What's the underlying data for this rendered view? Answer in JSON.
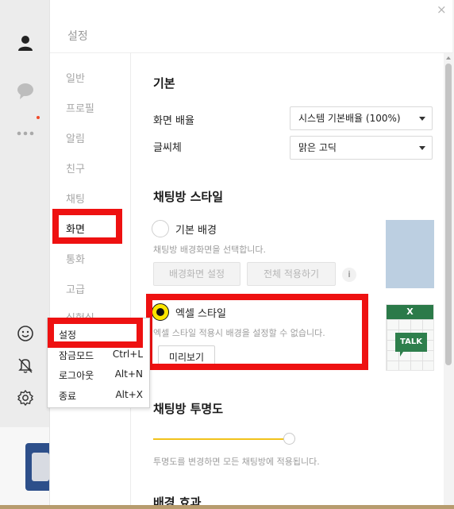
{
  "window": {
    "title": "설정",
    "close": "×"
  },
  "sidebar": {
    "items": [
      {
        "label": "일반"
      },
      {
        "label": "프로필"
      },
      {
        "label": "알림"
      },
      {
        "label": "친구"
      },
      {
        "label": "채팅"
      },
      {
        "label": "화면",
        "active": true
      },
      {
        "label": "통화"
      },
      {
        "label": "고급"
      },
      {
        "label": "실험실"
      }
    ]
  },
  "basic": {
    "section_title": "기본",
    "zoom_label": "화면 배율",
    "zoom_value": "시스템 기본배율 (100%)",
    "font_label": "글씨체",
    "font_value": "맑은 고딕"
  },
  "chat_style": {
    "section_title": "채팅방 스타일",
    "default_bg_label": "기본 배경",
    "default_bg_desc": "채팅방 배경화면을 선택합니다.",
    "set_bg_button": "배경화면 설정",
    "apply_all_button": "전체 적용하기",
    "info_icon": "i",
    "excel_label": "엑셀 스타일",
    "excel_desc": "엑셀 스타일 적용시 배경을 설정할 수 없습니다.",
    "preview_button": "미리보기",
    "excel_badge": "X",
    "talk_badge": "TALK"
  },
  "transparency": {
    "section_title": "채팅방 투명도",
    "desc": "투명도를 변경하면 모든 채팅방에 적용됩니다.",
    "level": 1.0
  },
  "background_effect": {
    "section_title": "배경 효과"
  },
  "context_menu": {
    "items": [
      {
        "label": "설정",
        "shortcut": ""
      },
      {
        "label": "잠금모드",
        "shortcut": "Ctrl+L"
      },
      {
        "label": "로그아웃",
        "shortcut": "Alt+N"
      },
      {
        "label": "종료",
        "shortcut": "Alt+X"
      }
    ]
  },
  "colors": {
    "accent_yellow": "#fde500",
    "annotation_red": "#ee1111",
    "excel_green": "#2b7a49",
    "bg_preview_blue": "#bccfe1"
  }
}
